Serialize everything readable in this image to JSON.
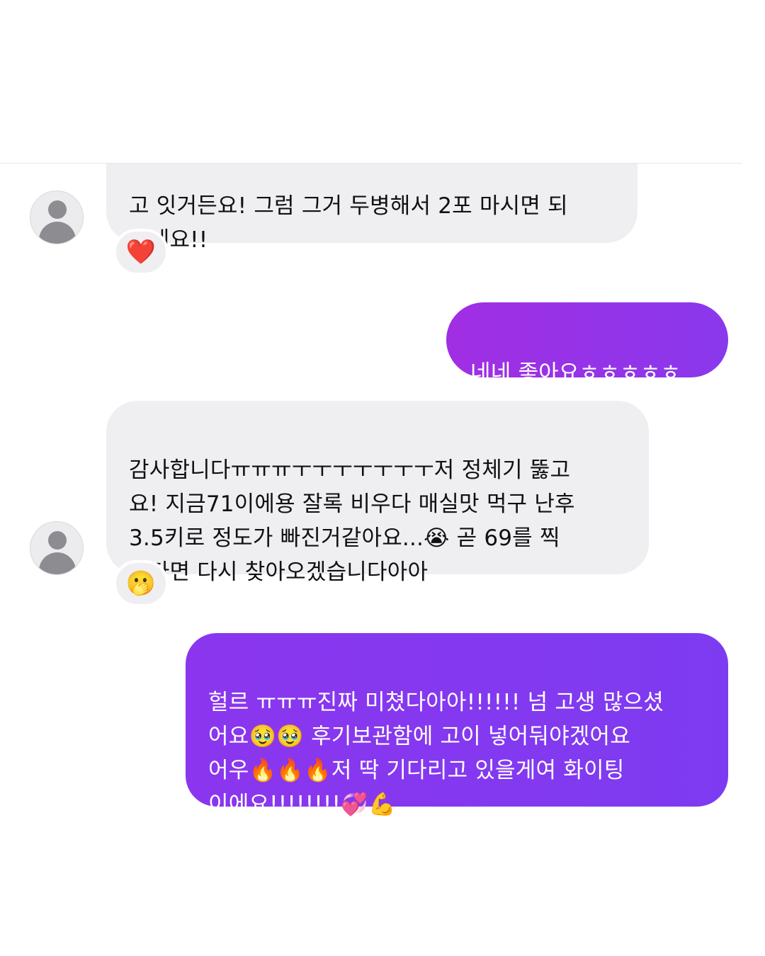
{
  "colors": {
    "incoming_bubble": "#efeff2",
    "outgoing_gradient_start": "#a12ee3",
    "outgoing_gradient_end": "#8a38ec",
    "outgoing_gradient2_start": "#8b36ee",
    "outgoing_gradient2_end": "#7d3bf1"
  },
  "messages": [
    {
      "direction": "incoming",
      "text": "고 잇거든요! 그럼 그거 두병해서 2포 마시면 되\n겠네요!!",
      "reaction": "❤️"
    },
    {
      "direction": "outgoing",
      "text": "네네 좋아요ㅎㅎㅎㅎㅎ"
    },
    {
      "direction": "incoming",
      "text": "감사합니다ㅠㅠㅠㅜㅜㅜㅜㅜㅜㅜ저 정체기 뚫고\n요! 지금71이에용 잘록 비우다 매실맛 먹구 난후\n3.5키로 정도가 빠진거같아요...😭 곧 69를 찍\n는다면 다시 찾아오겠습니다아아",
      "reaction": "🫢"
    },
    {
      "direction": "outgoing",
      "text": "헐르 ㅠㅠㅠ진짜 미쳤다아아!!!!!! 넘 고생 많으셨\n어요🥹🥹 후기보관함에 고이 넣어둬야겠어요\n어우🔥🔥🔥저 딱 기다리고 있을게여 화이팅\n이에요!!!!!!!!💞💪"
    }
  ]
}
